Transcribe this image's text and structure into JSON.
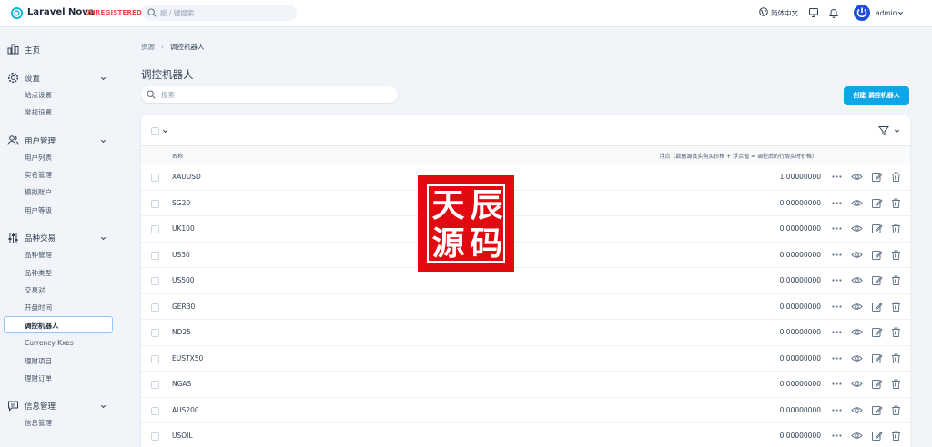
{
  "header": {
    "app_name": "Laravel Nova",
    "status": "UNREGISTERED",
    "search_placeholder": "按 / 键搜索",
    "language": "简体中文",
    "user": "admin"
  },
  "sidebar": {
    "dashboard": "主页",
    "sections": [
      {
        "label": "设置",
        "items": [
          "站点设置",
          "常规设置"
        ]
      },
      {
        "label": "用户管理",
        "items": [
          "用户列表",
          "实名管理",
          "模拟账户",
          "用户等级"
        ]
      },
      {
        "label": "品种交易",
        "items": [
          "品种管理",
          "品种类型",
          "交易对",
          "开盘时间",
          "调控机器人",
          "Currency Kxes",
          "理财项目",
          "理财订单"
        ]
      },
      {
        "label": "信息管理",
        "items": [
          "信息管理"
        ]
      }
    ],
    "active_item": "调控机器人"
  },
  "breadcrumb": {
    "root": "资源",
    "current": "调控机器人"
  },
  "page": {
    "title": "调控机器人",
    "search_placeholder": "搜索",
    "create_label": "创建 调控机器人"
  },
  "table": {
    "columns": {
      "name": "名称",
      "float": "浮点（数据源真实购买价格 + 浮点值 = 调控后的行情实时价格）"
    },
    "rows": [
      {
        "name": "XAUUSD",
        "value": "1.00000000"
      },
      {
        "name": "SG20",
        "value": "0.00000000"
      },
      {
        "name": "UK100",
        "value": "0.00000000"
      },
      {
        "name": "US30",
        "value": "0.00000000"
      },
      {
        "name": "US500",
        "value": "0.00000000"
      },
      {
        "name": "GER30",
        "value": "0.00000000"
      },
      {
        "name": "ND25",
        "value": "0.00000000"
      },
      {
        "name": "EUSTX50",
        "value": "0.00000000"
      },
      {
        "name": "NGAS",
        "value": "0.00000000"
      },
      {
        "name": "AUS200",
        "value": "0.00000000"
      },
      {
        "name": "USOIL",
        "value": "0.00000000"
      }
    ]
  },
  "watermark": {
    "chars": [
      "天",
      "辰",
      "源",
      "码"
    ],
    "color": "#e10a10"
  },
  "colors": {
    "accent": "#0ea5e9",
    "brand": "#1d4ed8",
    "danger": "#ef4444"
  }
}
